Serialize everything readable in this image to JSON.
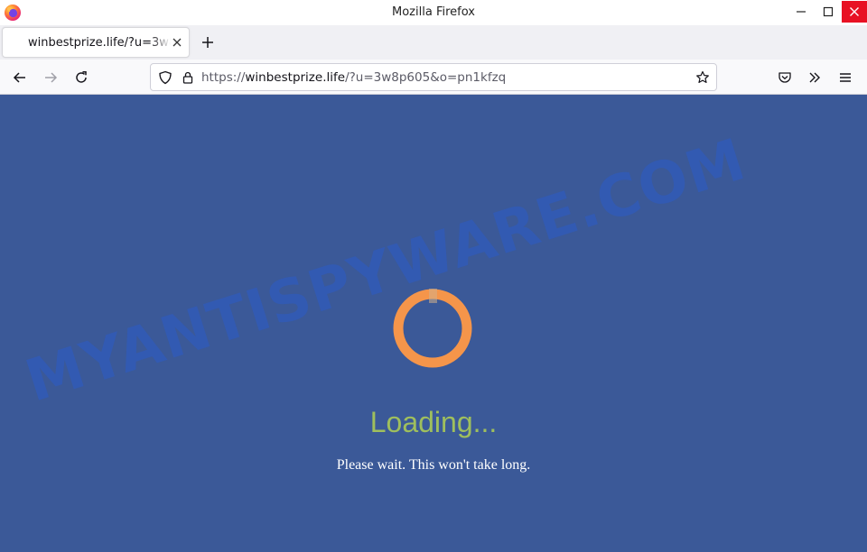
{
  "window": {
    "title": "Mozilla Firefox",
    "icons": {
      "app": "firefox-icon",
      "minimize": "minimize-icon",
      "maximize": "maximize-icon",
      "close": "close-icon"
    },
    "close_color": "#e81123"
  },
  "tabs": [
    {
      "title": "winbestprize.life/?u=3w8p605&o=pn1kfzq",
      "active": true
    }
  ],
  "navbar": {
    "url_scheme": "https://",
    "url_host": "winbestprize.life",
    "url_rest": "/?u=3w8p605&o=pn1kfzq",
    "icons": [
      "back-arrow-icon",
      "forward-arrow-icon",
      "reload-icon",
      "shield-icon",
      "lock-icon",
      "bookmark-star-icon",
      "pocket-icon",
      "overflow-chevron-icon",
      "hamburger-menu-icon"
    ]
  },
  "page": {
    "background": "#3b5998",
    "loading_text": "Loading...",
    "loading_color": "#9fbf5d",
    "spinner_color": "#f5954a",
    "wait_text": "Please wait. This won't take long.",
    "watermark": "MYANTISPYWARE.COM"
  }
}
